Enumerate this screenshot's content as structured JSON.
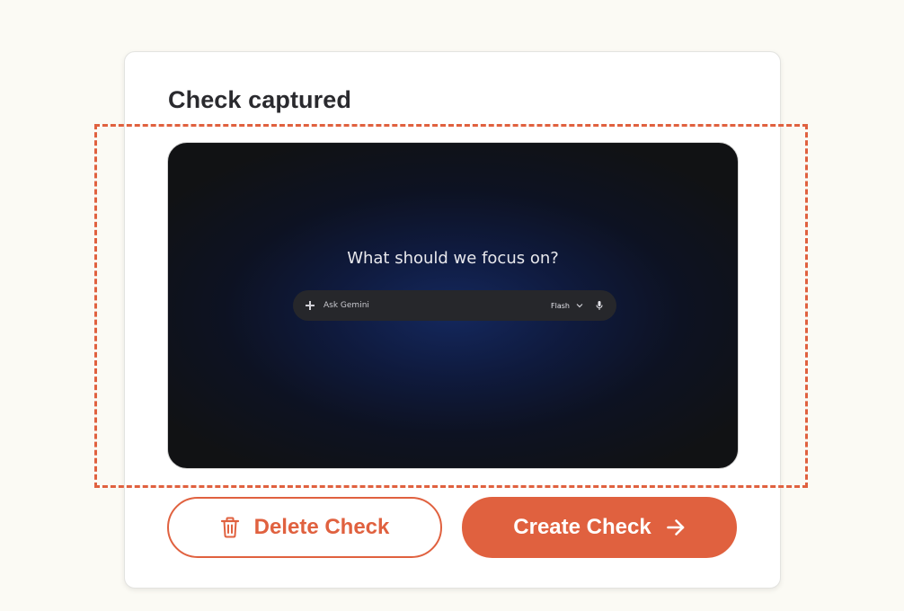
{
  "card": {
    "title": "Check captured"
  },
  "preview": {
    "heading": "What should we focus on?",
    "ask_bar": {
      "placeholder": "Ask Gemini",
      "model": "Flash",
      "icons": [
        "plus-icon",
        "chevron-down-icon",
        "microphone-icon"
      ]
    }
  },
  "actions": {
    "delete_label": "Delete Check",
    "create_label": "Create Check",
    "delete_icon": "trash-icon",
    "create_icon": "arrow-right-icon"
  },
  "colors": {
    "accent": "#e0613f",
    "page_background": "#fbfaf4",
    "card_background": "#ffffff",
    "title_text": "#2a2a2e"
  }
}
